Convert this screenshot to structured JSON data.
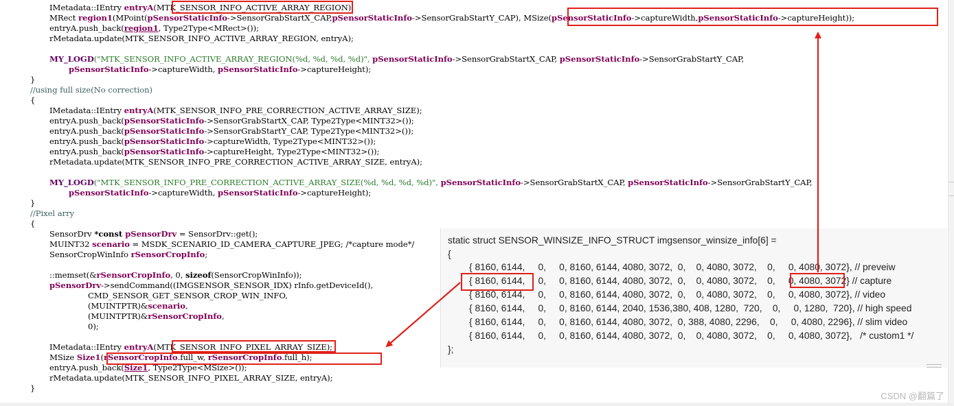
{
  "code": {
    "l0_a": "IMetadata::IEntry ",
    "l0_b": "entryA",
    "l0_c": "(MTK_SENSOR_INFO_ACTIVE_ARRAY_REGION);",
    "l1_a": "MRect ",
    "l1_b": "region1",
    "l1_c": "(MPoint(",
    "l1_d": "pSensorStaticInfo",
    "l1_e": "->SensorGrabStartX_CAP,",
    "l1_f": "pSensorStaticInfo",
    "l1_g": "->SensorGrabStartY_CAP), MSize(",
    "l1_h": "pSensorStaticInfo",
    "l1_i": "->captureWidth,",
    "l1_j": "pSensorStaticInfo",
    "l1_k": "->captureHeight));",
    "l2_a": "entryA.push_back(",
    "l2_b": "region1",
    "l2_c": ", Type2Type<MRect>());",
    "l3": "rMetadata.update(MTK_SENSOR_INFO_ACTIVE_ARRAY_REGION, entryA);",
    "l5_a": "MY_LOGD",
    "l5_b": "(\"MTK_SENSOR_INFO_ACTIVE_ARRAY_REGION(%d, %d, %d, %d)\", ",
    "l5_c": "pSensorStaticInfo",
    "l5_d": "->SensorGrabStartX_CAP, ",
    "l5_e": "pSensorStaticInfo",
    "l5_f": "->SensorGrabStartY_CAP,",
    "l6_a": "pSensorStaticInfo",
    "l6_b": "->captureWidth, ",
    "l6_c": "pSensorStaticInfo",
    "l6_d": "->captureHeight);",
    "l7": "}",
    "l8": "//using full size(No correction)",
    "l9": "{",
    "l10_a": "IMetadata::IEntry ",
    "l10_b": "entryA",
    "l10_c": "(MTK_SENSOR_INFO_PRE_CORRECTION_ACTIVE_ARRAY_SIZE);",
    "l11_a": "entryA.push_back(",
    "l11_b": "pSensorStaticInfo",
    "l11_c": "->SensorGrabStartX_CAP, Type2Type<MINT32>());",
    "l12_a": "entryA.push_back(",
    "l12_b": "pSensorStaticInfo",
    "l12_c": "->SensorGrabStartY_CAP, Type2Type<MINT32>());",
    "l13_a": "entryA.push_back(",
    "l13_b": "pSensorStaticInfo",
    "l13_c": "->captureWidth, Type2Type<MINT32>());",
    "l14_a": "entryA.push_back(",
    "l14_b": "pSensorStaticInfo",
    "l14_c": "->captureHeight, Type2Type<MINT32>());",
    "l15": "rMetadata.update(MTK_SENSOR_INFO_PRE_CORRECTION_ACTIVE_ARRAY_SIZE, entryA);",
    "l17_a": "MY_LOGD",
    "l17_b": "(\"MTK_SENSOR_INFO_PRE_CORRECTION_ACTIVE_ARRAY_SIZE(%d, %d, %d, %d)\", ",
    "l17_c": "pSensorStaticInfo",
    "l17_d": "->SensorGrabStartX_CAP, ",
    "l17_e": "pSensorStaticInfo",
    "l17_f": "->SensorGrabStartY_CAP,",
    "l18_a": "pSensorStaticInfo",
    "l18_b": "->captureWidth, ",
    "l18_c": "pSensorStaticInfo",
    "l18_d": "->captureHeight);",
    "l19": "}",
    "l20": "//Pixel arry",
    "l21": "{",
    "l22_a": "SensorDrv ",
    "l22_b": "*const ",
    "l22_c": "pSensorDrv",
    "l22_d": " = SensorDrv::get();",
    "l23_a": "MUINT32 ",
    "l23_b": "scenario",
    "l23_c": " = MSDK_SCENARIO_ID_CAMERA_CAPTURE_JPEG; /*capture mode*/",
    "l24_a": "SensorCropWinInfo ",
    "l24_b": "rSensorCropInfo",
    "l24_c": ";",
    "l26_a": "::memset(&",
    "l26_b": "rSensorCropInfo",
    "l26_c": ", 0, ",
    "l26_d": "sizeof",
    "l26_e": "(SensorCropWinInfo));",
    "l27_a": "pSensorDrv",
    "l27_b": "->sendCommand((IMGSENSOR_SENSOR_IDX) rInfo.getDeviceId(),",
    "l28": "CMD_SENSOR_GET_SENSOR_CROP_WIN_INFO,",
    "l29_a": "(MUINTPTR)&",
    "l29_b": "scenario",
    "l29_c": ",",
    "l30_a": "(MUINTPTR)&",
    "l30_b": "rSensorCropInfo",
    "l30_c": ",",
    "l31": "0);",
    "l33_a": "IMetadata::IEntry ",
    "l33_b": "entryA",
    "l33_c": "(MTK_SENSOR_INFO_PIXEL_ARRAY_SIZE);",
    "l34_a": "MSize ",
    "l34_b": "Size1",
    "l34_c": "(",
    "l34_d": "rSensorCropInfo",
    "l34_e": ".full_w, ",
    "l34_f": "rSensorCropInfo",
    "l34_g": ".full_h);",
    "l35_a": "entryA.push_back(",
    "l35_b": "Size1",
    "l35_c": ", Type2Type<MSize>());",
    "l36": "rMetadata.update(MTK_SENSOR_INFO_PIXEL_ARRAY_SIZE, entryA);",
    "l37": "}"
  },
  "struct_panel": {
    "header": "static struct SENSOR_WINSIZE_INFO_STRUCT imgsensor_winsize_info[6] =",
    "open": "{",
    "rows": [
      "{ 8160, 6144,     0,     0, 8160, 6144, 4080, 3072,  0,    0, 4080, 3072,    0,     0, 4080, 3072}, // preveiw",
      "{ 8160, 6144,     0,     0, 8160, 6144, 4080, 3072,  0,    0, 4080, 3072,    0,     0, 4080, 3072} // capture",
      "{ 8160, 6144,     0,     0, 8160, 6144, 4080, 3072,  0,    0, 4080, 3072,    0,     0, 4080, 3072}, // video",
      "{ 8160, 6144,     0,     0, 8160, 6144, 2040, 1536,380, 408, 1280,  720,    0,     0, 1280,  720}, // high speed",
      "{ 8160, 6144,     0,     0, 8160, 6144, 4080, 3072,  0, 388, 4080, 2296,    0,     0, 4080, 2296}, // slim video",
      "{ 8160, 6144,     0,     0, 8160, 6144, 4080, 3072,  0,    0, 4080, 3072,    0,     0, 4080, 3072},   /* custom1 */"
    ],
    "close": "};"
  },
  "watermark": "CSDN @翻篇了",
  "colors": {
    "highlight": "#e0201a",
    "keyword_purple": "#7f0055",
    "panel_bg": "#f7f7f7"
  }
}
